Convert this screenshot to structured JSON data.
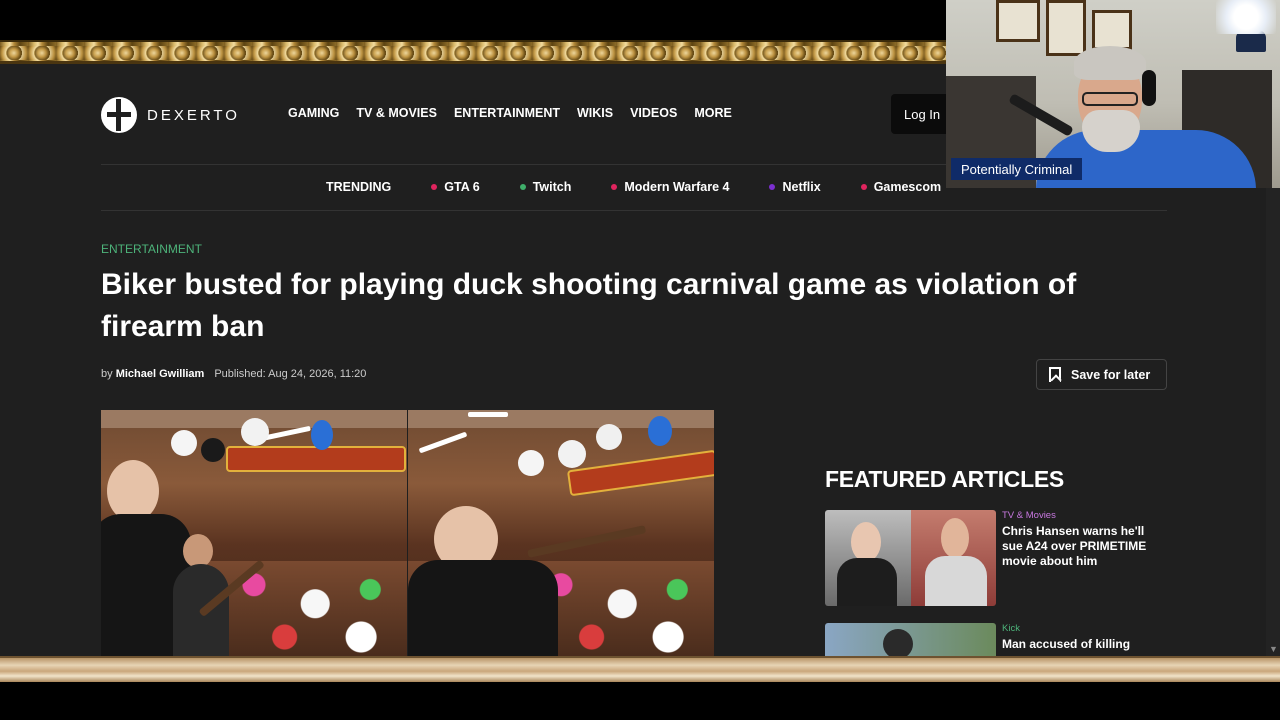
{
  "header": {
    "logo_text": "DEXERTO",
    "nav": [
      "GAMING",
      "TV & MOVIES",
      "ENTERTAINMENT",
      "WIKIS",
      "VIDEOS",
      "MORE"
    ],
    "login_label": "Log In"
  },
  "trending": {
    "label": "TRENDING",
    "items": [
      {
        "label": "GTA 6",
        "color": "#e0245e"
      },
      {
        "label": "Twitch",
        "color": "#3fae6a"
      },
      {
        "label": "Modern Warfare 4",
        "color": "#e0245e"
      },
      {
        "label": "Netflix",
        "color": "#7b2fd0"
      },
      {
        "label": "Gamescom",
        "color": "#e0245e"
      }
    ]
  },
  "article": {
    "category": "ENTERTAINMENT",
    "title": "Biker busted for playing duck shooting carnival game as violation of firearm ban",
    "by_prefix": "by",
    "author": "Michael Gwilliam",
    "published": "Published: Aug 24, 2026, 11:20",
    "save_label": "Save for later"
  },
  "featured": {
    "heading": "FEATURED ARTICLES",
    "cards": [
      {
        "tag": "TV & Movies",
        "tag_color": "#c878e0",
        "title": "Chris Hansen warns he'll sue A24 over PRIMETIME movie about him"
      },
      {
        "tag": "Kick",
        "tag_color": "#4db37a",
        "title": "Man accused of killing"
      }
    ]
  },
  "webcam": {
    "label": "Potentially Criminal"
  },
  "icons": {
    "logo": "dexerto-logo-icon",
    "save": "bookmark-icon",
    "scroll": "scroll-down-arrow-icon"
  }
}
